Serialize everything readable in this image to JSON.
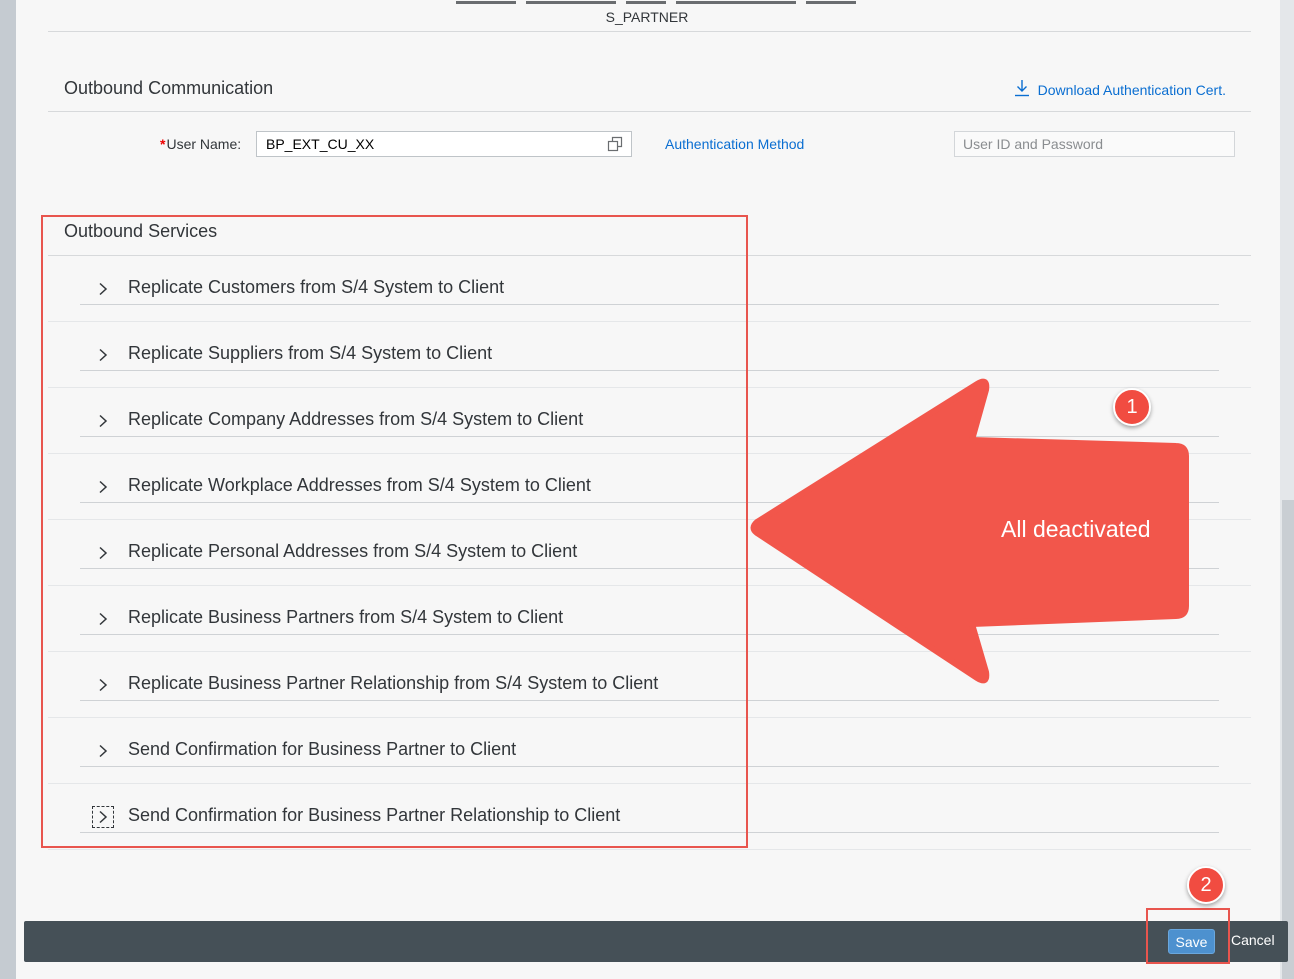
{
  "header": {
    "partner_label": "S_PARTNER"
  },
  "outbound_communication": {
    "title": "Outbound Communication",
    "download_link": "Download Authentication Cert.",
    "user_name_required": "*",
    "user_name_label": "User Name:",
    "user_name_value": "BP_EXT_CU_XX",
    "auth_method_label": "Authentication Method",
    "auth_method_value": "User ID and Password"
  },
  "outbound_services": {
    "title": "Outbound Services",
    "items": [
      {
        "label": "Replicate Customers from S/4 System to Client"
      },
      {
        "label": "Replicate Suppliers from S/4 System to Client"
      },
      {
        "label": "Replicate Company Addresses from S/4 System to Client"
      },
      {
        "label": "Replicate Workplace Addresses from S/4 System to Client"
      },
      {
        "label": "Replicate Personal Addresses from S/4 System to Client"
      },
      {
        "label": "Replicate Business Partners from S/4 System to Client"
      },
      {
        "label": "Replicate Business Partner Relationship from S/4 System to Client"
      },
      {
        "label": "Send Confirmation for Business Partner to Client"
      },
      {
        "label": "Send Confirmation for Business Partner Relationship to Client"
      }
    ]
  },
  "annotations": {
    "arrow_text": "All deactivated",
    "badge_1": "1",
    "badge_2": "2",
    "annotation_color": "#f2564b"
  },
  "footer": {
    "save_label": "Save",
    "cancel_label": "Cancel"
  },
  "icons": {
    "chevron": "chevron-right-icon",
    "download": "download-icon",
    "value_help": "value-help-icon"
  }
}
